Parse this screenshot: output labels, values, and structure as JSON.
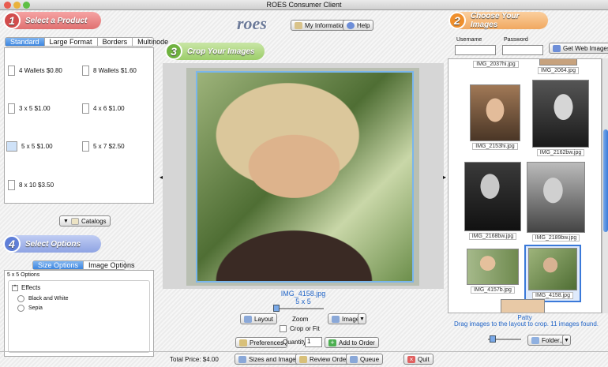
{
  "window": {
    "title": "ROES Consumer Client"
  },
  "logo": "roes",
  "header": {
    "my_info": "My Information",
    "help": "Help"
  },
  "steps": {
    "s1": {
      "num": "1",
      "label": "Select a Product"
    },
    "s2": {
      "num": "2",
      "label": "Choose Your Images"
    },
    "s3": {
      "num": "3",
      "label": "Crop Your Images"
    },
    "s4": {
      "num": "4",
      "label": "Select Options"
    }
  },
  "product_tabs": [
    "Standard",
    "Large Format",
    "Borders",
    "Multinode"
  ],
  "sizes": [
    "4 Wallets $0.80",
    "8 Wallets $1.60",
    "3 x 5 $1.00",
    "4 x 6 $1.00",
    "5 x 5 $1.00",
    "5 x 7 $2.50",
    "8 x 10 $3.50"
  ],
  "catalogs": "Catalogs",
  "option_tabs": [
    "Size Options",
    "Image Options"
  ],
  "options": {
    "group": "5 x 5 Options",
    "effects": "Effects",
    "items": [
      "Black and White",
      "Sepia"
    ]
  },
  "crop": {
    "filename": "IMG_4158.jpg",
    "size": "5 x 5",
    "layout": "Layout",
    "zoom": "Zoom",
    "image": "Image",
    "crop_or_fit": "Crop or Fit",
    "preferences": "Preferences",
    "quantity_label": "Quantity",
    "quantity": "1",
    "add": "Add to Order"
  },
  "login": {
    "username_label": "Username",
    "password_label": "Password",
    "username": "",
    "password": "",
    "get": "Get Web Images"
  },
  "thumbs": [
    "IMG_2037hi.jpg",
    "IMG_2064.jpg",
    "IMG_2153hi.jpg",
    "IMG_2162bw.jpg",
    "IMG_2168bw.jpg",
    "IMG_2189bw.jpg",
    "IMG_4157b.jpg",
    "IMG_4158.jpg"
  ],
  "browser": {
    "folder_name": "Patty",
    "status": "Drag images to the layout to crop. 11 images found.",
    "folder_btn": "Folder..."
  },
  "bottom": {
    "total": "Total Price: $4.00",
    "sizes": "Sizes and Images",
    "review": "Review Order",
    "queue": "Queue",
    "quit": "Quit"
  }
}
